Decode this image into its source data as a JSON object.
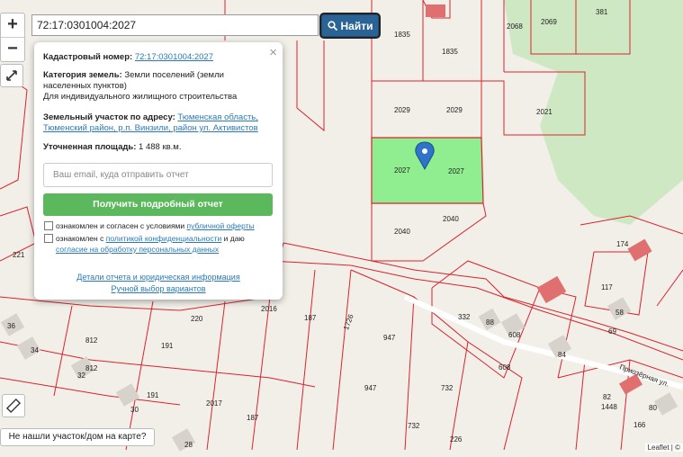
{
  "search": {
    "value": "72:17:0301004:2027",
    "button_label": "Найти"
  },
  "zoom": {
    "in_label": "+",
    "out_label": "−"
  },
  "popup": {
    "close_label": "×",
    "cadastral_label": "Кадастровый номер:",
    "cadastral_value": "72:17:0301004:2027",
    "category_label": "Категория земель:",
    "category_value": "Земли поселений (земли населенных пунктов)",
    "purpose": "Для индивидуального жилищного строительства",
    "address_label": "Земельный участок по адресу:",
    "address_value": "Тюменская область, Тюменский район, р.п. Винзили, район ул. Активистов",
    "area_label": "Уточненная площадь:",
    "area_value": "1 488 кв.м.",
    "email_placeholder": "Ваш email, куда отправить отчет",
    "report_button": "Получить подробный отчет",
    "consent1_text": "ознакомлен и согласен с условиями",
    "consent1_link": "публичной оферты",
    "consent2_text": "ознакомлен с",
    "consent2_link": "политикой конфиденциальности",
    "consent2_and": "и даю",
    "consent2_link2": "согласие на обработку персональных данных",
    "details_link": "Детали отчета и юридическая информация",
    "manual_link": "Ручной выбор вариантов"
  },
  "not_found_label": "Не нашли участок/дом на карте?",
  "attribution": "Leaflet | ©",
  "map_labels": {
    "l1835a": "1835",
    "l1835b": "1835",
    "l2068": "2068",
    "l2069": "2069",
    "l381": "381",
    "l2029a": "2029",
    "l2029b": "2029",
    "l2021": "2021",
    "l2027a": "2027",
    "l2027b": "2027",
    "l2040a": "2040",
    "l2040b": "2040",
    "l221": "221",
    "l220": "220",
    "l2016": "2016",
    "l187a": "187",
    "l1726": "1726",
    "l332": "332",
    "l88": "88",
    "l608a": "608",
    "l608b": "608",
    "l947a": "947",
    "l947b": "947",
    "l812a": "812",
    "l812b": "812",
    "l191a": "191",
    "l191b": "191",
    "l2017": "2017",
    "l187b": "187",
    "l732a": "732",
    "l732b": "732",
    "l226": "226",
    "l36": "36",
    "l34": "34",
    "l32": "32",
    "l30": "30",
    "l28": "28",
    "l174": "174",
    "l117": "117",
    "l58": "58",
    "l69": "69",
    "l84": "84",
    "l82": "82",
    "l1448": "1448",
    "l80": "80",
    "l166": "166",
    "street": "Приозёрная ул."
  },
  "colors": {
    "parcel_line": "#d9232d",
    "selected_fill": "#90ee90",
    "park": "#cfe8c4",
    "marker": "#2f74c8",
    "building": "#e07070",
    "search_button": "#2a6496",
    "report_button": "#5cb85c"
  }
}
